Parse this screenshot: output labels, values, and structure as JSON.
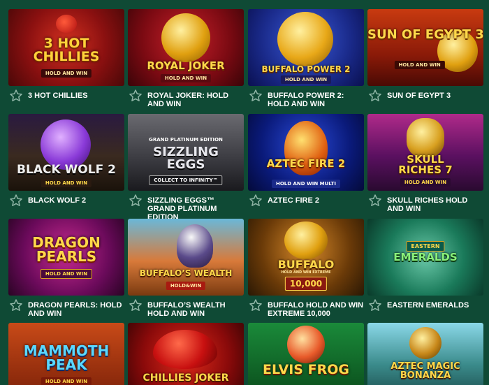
{
  "games": [
    {
      "title": "3 HOT CHILLIES",
      "art": "3 HOT\nCHILLIES",
      "sub": "HOLD AND WIN",
      "icon": "star-outline-icon"
    },
    {
      "title": "ROYAL JOKER: HOLD AND WIN",
      "art": "ROYAL JOKER",
      "sub": "HOLD AND WIN",
      "icon": "star-outline-icon"
    },
    {
      "title": "BUFFALO POWER 2: HOLD AND WIN",
      "art": "BUFFALO POWER 2",
      "sub": "HOLD AND WIN",
      "icon": "star-outline-icon"
    },
    {
      "title": "SUN OF EGYPT 3",
      "art": "SUN OF EGYPT 3",
      "sub": "HOLD AND WIN",
      "icon": "star-outline-icon"
    },
    {
      "title": "BLACK WOLF 2",
      "art": "BLACK WOLF 2",
      "sub": "HOLD AND WIN",
      "icon": "star-outline-icon"
    },
    {
      "title": "SIZZLING EGGS™ GRAND PLATINUM EDITION",
      "art": "SIZZLING\nEGGS",
      "sub": "COLLECT TO INFINITY™",
      "top": "GRAND PLATINUM EDITION",
      "icon": "star-outline-icon"
    },
    {
      "title": "AZTEC FIRE 2",
      "art": "AZTEC FIRE 2",
      "sub": "HOLD AND WIN MULTI",
      "icon": "star-outline-icon"
    },
    {
      "title": "SKULL RICHES HOLD AND WIN",
      "art": "SKULL\nRICHES 7",
      "sub": "HOLD AND WIN",
      "icon": "star-outline-icon"
    },
    {
      "title": "DRAGON PEARLS: HOLD AND WIN",
      "art": "DRAGON\nPEARLS",
      "sub": "HOLD AND WIN",
      "icon": "star-outline-icon"
    },
    {
      "title": "BUFFALO’S WEALTH HOLD AND WIN",
      "art": "BUFFALO’S WEALTH",
      "sub": "HOLD&WIN",
      "icon": "star-outline-icon"
    },
    {
      "title": "BUFFALO HOLD AND WIN EXTREME 10,000",
      "art": "BUFFALO",
      "sub": "10,000",
      "top": "HOLD AND WIN EXTREME",
      "icon": "star-outline-icon"
    },
    {
      "title": "EASTERN EMERALDS",
      "art": "EMERALDS",
      "sub": "",
      "top": "EASTERN",
      "icon": "star-outline-icon"
    },
    {
      "title": "",
      "art": "MAMMOTH\nPEAK",
      "sub": "HOLD AND WIN",
      "icon": "star-outline-icon"
    },
    {
      "title": "",
      "art": "CHILLIES JOKER",
      "sub": "",
      "top": "",
      "icon": "star-outline-icon"
    },
    {
      "title": "",
      "art": "ELVIS FROG",
      "sub": "",
      "icon": "star-outline-icon"
    },
    {
      "title": "",
      "art": "AZTEC MAGIC\nBONANZA",
      "sub": "",
      "icon": "star-outline-icon"
    }
  ],
  "colors": {
    "background": "#0f4a35",
    "title": "#ffffff",
    "star": "#8fb5a6"
  }
}
